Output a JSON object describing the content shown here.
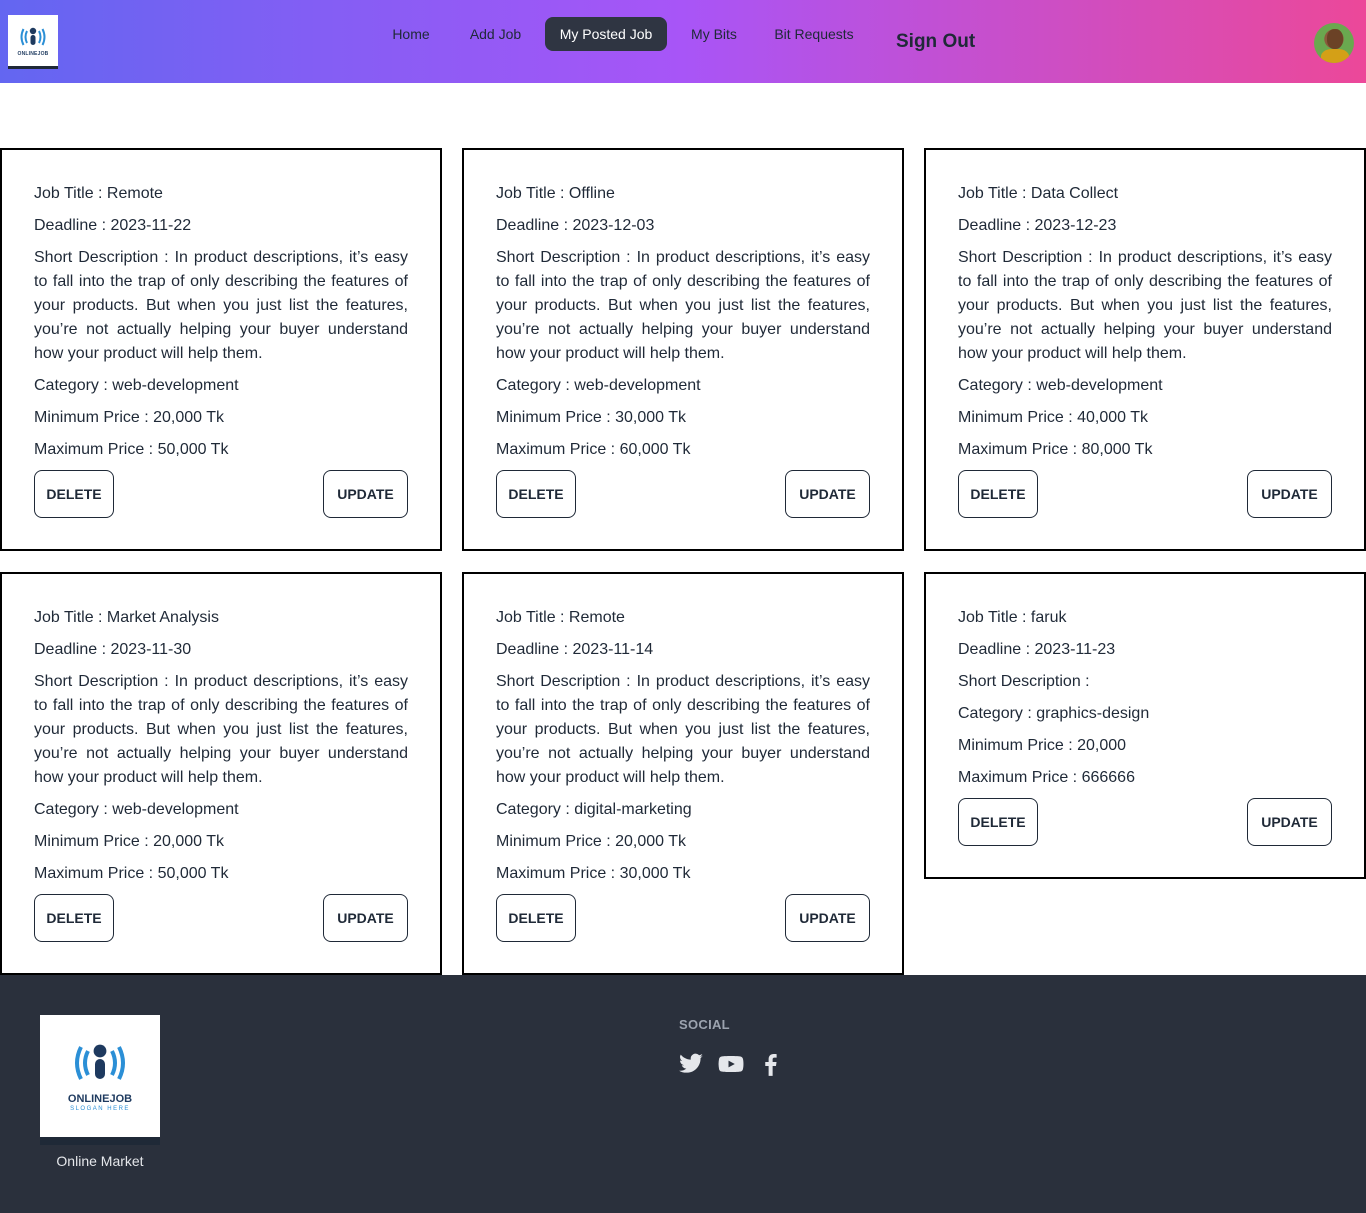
{
  "navbar": {
    "logo_text": "ONLINEJOB",
    "items": [
      {
        "label": "Home",
        "active": false
      },
      {
        "label": "Add Job",
        "active": false
      },
      {
        "label": "My Posted Job",
        "active": true
      },
      {
        "label": "My Bits",
        "active": false
      },
      {
        "label": "Bit Requests",
        "active": false
      }
    ],
    "sign_out": "Sign Out",
    "avatar_icon": "user-avatar"
  },
  "labels": {
    "job_title": "Job Title : ",
    "deadline": "Deadline : ",
    "short_description": "Short Description : ",
    "category": "Category : ",
    "min_price": "Minimum Price : ",
    "max_price": "Maximum Price : ",
    "delete": "DELETE",
    "update": "UPDATE"
  },
  "jobs": [
    {
      "title": "Remote",
      "deadline": "2023-11-22",
      "description": "In product descriptions, it’s easy to fall into the trap of only describing the features of your products. But when you just list the features, you’re not actually helping your buyer understand how your product will help them.",
      "category": "web-development",
      "min_price": "20,000 Tk",
      "max_price": "50,000 Tk"
    },
    {
      "title": "Offline",
      "deadline": "2023-12-03",
      "description": "In product descriptions, it’s easy to fall into the trap of only describing the features of your products. But when you just list the features, you’re not actually helping your buyer understand how your product will help them.",
      "category": "web-development",
      "min_price": "30,000 Tk",
      "max_price": "60,000 Tk"
    },
    {
      "title": "Data Collect",
      "deadline": "2023-12-23",
      "description": "In product descriptions, it’s easy to fall into the trap of only describing the features of your products. But when you just list the features, you’re not actually helping your buyer understand how your product will help them.",
      "category": "web-development",
      "min_price": "40,000 Tk",
      "max_price": "80,000 Tk"
    },
    {
      "title": "Market Analysis",
      "deadline": "2023-11-30",
      "description": "In product descriptions, it’s easy to fall into the trap of only describing the features of your products. But when you just list the features, you’re not actually helping your buyer understand how your product will help them.",
      "category": "web-development",
      "min_price": "20,000 Tk",
      "max_price": "50,000 Tk"
    },
    {
      "title": "Remote",
      "deadline": "2023-11-14",
      "description": "In product descriptions, it’s easy to fall into the trap of only describing the features of your products. But when you just list the features, you’re not actually helping your buyer understand how your product will help them.",
      "category": "digital-marketing",
      "min_price": "20,000 Tk",
      "max_price": "30,000 Tk"
    },
    {
      "title": "faruk",
      "deadline": "2023-11-23",
      "description": "",
      "category": "graphics-design",
      "min_price": "20,000",
      "max_price": "666666"
    }
  ],
  "footer": {
    "logo_text": "ONLINEJOB",
    "logo_sub": "SLOGAN HERE",
    "caption": "Online Market",
    "social_title": "SOCIAL",
    "social_icons": [
      "twitter-icon",
      "youtube-icon",
      "facebook-icon"
    ]
  },
  "colors": {
    "nav_gradient_start": "#6366f1",
    "nav_gradient_mid": "#a855f7",
    "nav_gradient_end": "#ec4899",
    "active_nav": "#2f3542",
    "footer_bg": "#2a303c",
    "logo_blue": "#2b8fd6",
    "logo_navy": "#1e3a5f"
  }
}
